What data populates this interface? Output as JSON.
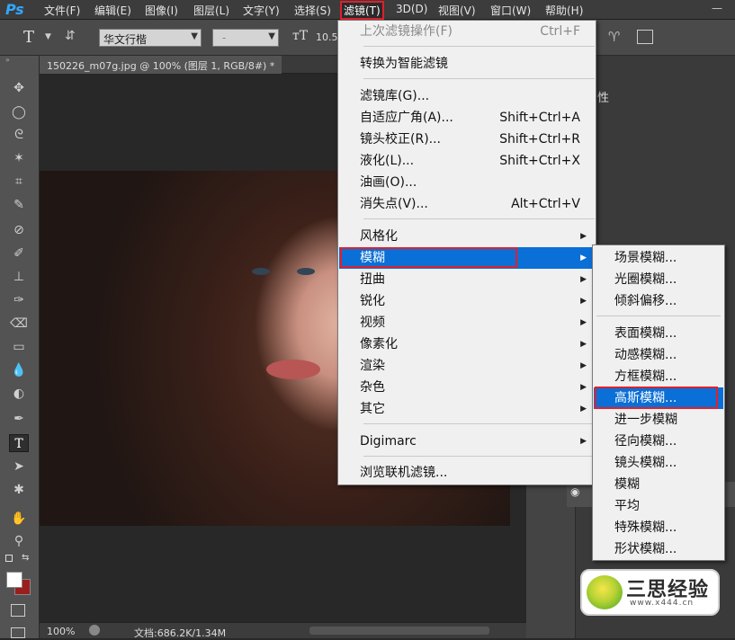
{
  "app": {
    "logo": "Ps",
    "minimize_glyph": "—"
  },
  "menubar": {
    "items": [
      "文件(F)",
      "编辑(E)",
      "图像(I)",
      "图层(L)",
      "文字(Y)",
      "选择(S)",
      "滤镜(T)",
      "3D(D)",
      "视图(V)",
      "窗口(W)",
      "帮助(H)"
    ],
    "active": "滤镜(T)"
  },
  "options": {
    "tool_glyph": "T",
    "font_family": "华文行楷",
    "font_style": "-",
    "font_size": "10.5"
  },
  "document": {
    "tab_title": "150226_m07g.jpg @ 100% (图层 1, RGB/8#) *",
    "zoom": "100%",
    "doc_size": "文档:686.2K/1.34M"
  },
  "right_panel": {
    "fragment_char": "性"
  },
  "filter_menu": {
    "last_filter": {
      "label": "上次滤镜操作(F)",
      "shortcut": "Ctrl+F"
    },
    "convert_smart": "转换为智能滤镜",
    "filter_gallery": "滤镜库(G)...",
    "adaptive_wide": {
      "label": "自适应广角(A)...",
      "shortcut": "Shift+Ctrl+A"
    },
    "lens_correction": {
      "label": "镜头校正(R)...",
      "shortcut": "Shift+Ctrl+R"
    },
    "liquify": {
      "label": "液化(L)...",
      "shortcut": "Shift+Ctrl+X"
    },
    "oil_paint": "油画(O)...",
    "vanishing_point": {
      "label": "消失点(V)...",
      "shortcut": "Alt+Ctrl+V"
    },
    "stylize": "风格化",
    "blur": "模糊",
    "distort": "扭曲",
    "sharpen": "锐化",
    "video": "视频",
    "pixelate": "像素化",
    "render": "渲染",
    "noise": "杂色",
    "other": "其它",
    "digimarc": "Digimarc",
    "browse_online": "浏览联机滤镜..."
  },
  "blur_submenu": {
    "field_blur": "场景模糊...",
    "iris_blur": "光圈模糊...",
    "tilt_shift": "倾斜偏移...",
    "surface_blur": "表面模糊...",
    "motion_blur": "动感模糊...",
    "box_blur": "方框模糊...",
    "gaussian_blur": "高斯模糊...",
    "blur_more": "进一步模糊",
    "radial_blur": "径向模糊...",
    "lens_blur": "镜头模糊...",
    "blur": "模糊",
    "average": "平均",
    "smart_blur": "特殊模糊...",
    "shape_blur": "形状模糊..."
  },
  "watermark": {
    "title": "三思经验",
    "url": "www.x444.cn"
  },
  "colors": {
    "highlight": "#0a6fd6",
    "annotation_red": "#e0202c"
  }
}
